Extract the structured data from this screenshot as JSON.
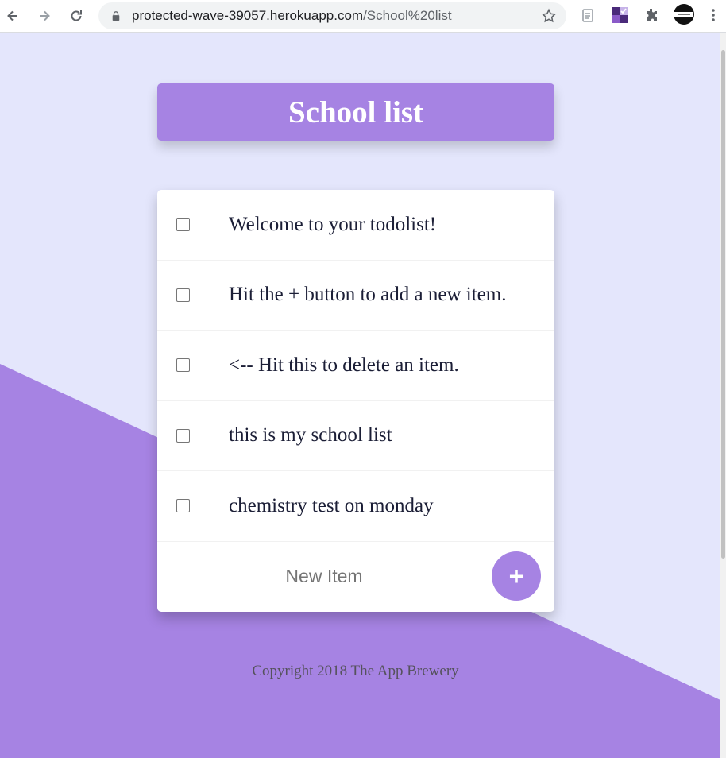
{
  "browser": {
    "url_host": "protected-wave-39057.herokuapp.com",
    "url_path": "/School%20list",
    "icons": [
      "back-arrow-icon",
      "forward-arrow-icon",
      "reload-icon",
      "lock-icon",
      "bookmark-star-icon",
      "tab-search-icon",
      "extension-icon",
      "puzzle-extensions-icon",
      "profile-avatar-icon",
      "menu-kebab-icon"
    ]
  },
  "page": {
    "title": "School list",
    "items": [
      {
        "text": "Welcome to your todolist!",
        "checked": false
      },
      {
        "text": "Hit the + button to add a new item.",
        "checked": false
      },
      {
        "text": "<-- Hit this to delete an item.",
        "checked": false
      },
      {
        "text": "this is my school list",
        "checked": false
      },
      {
        "text": "chemistry test on monday",
        "checked": false
      }
    ],
    "new_item_placeholder": "New Item",
    "add_button_label": "+",
    "footer": "Copyright 2018 The App Brewery"
  },
  "colors": {
    "background": "#e4e6fc",
    "accent": "#a683e3",
    "text": "#1b1e36"
  }
}
